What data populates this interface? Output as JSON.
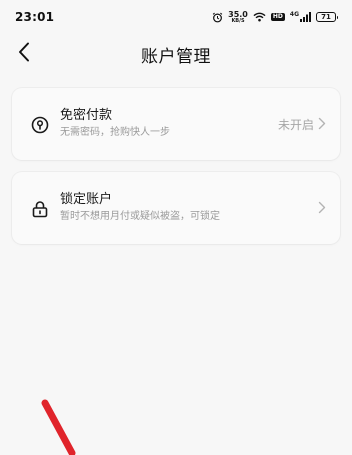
{
  "status_bar": {
    "time": "23:01",
    "net_speed_value": "35.0",
    "net_speed_unit": "KB/S",
    "hd_label": "HD",
    "signal_label": "4G",
    "battery_level": "71"
  },
  "nav": {
    "title": "账户管理",
    "back_icon": "chevron-left-icon"
  },
  "cards": [
    {
      "icon": "key-lock-icon",
      "title": "免密付款",
      "subtitle": "无需密码，抢购快人一步",
      "status": "未开启",
      "arrow_icon": "chevron-right-icon"
    },
    {
      "icon": "padlock-icon",
      "title": "锁定账户",
      "subtitle": "暂时不想用月付或疑似被盗，可锁定",
      "status": "",
      "arrow_icon": "chevron-right-icon"
    }
  ],
  "colors": {
    "background": "#f7f7f7",
    "card": "#fafafa",
    "annotation": "#e0242b"
  }
}
